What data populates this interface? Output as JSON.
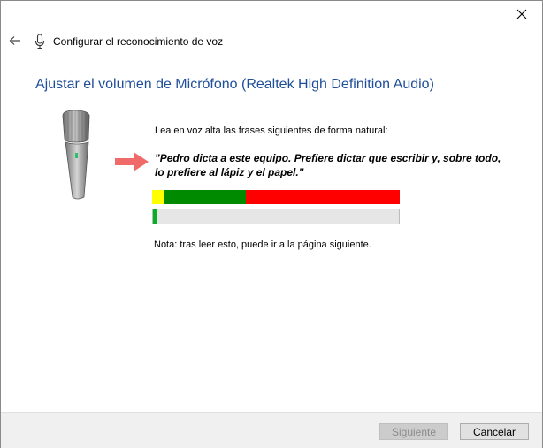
{
  "titlebar": {
    "close_icon": "close-icon"
  },
  "nav": {
    "back_icon": "arrow-left-icon",
    "mic_icon": "microphone-icon",
    "title": "Configurar el reconocimiento de voz"
  },
  "main": {
    "heading": "Ajustar el volumen de Micrófono (Realtek High Definition Audio)",
    "instruction": "Lea en voz alta las frases siguientes de forma natural:",
    "phrase": "\"Pedro dicta a este equipo. Prefiere dictar que escribir y, sobre todo, lo prefiere al lápiz y el papel.\"",
    "note": "Nota: tras leer esto, puede ir a la página siguiente.",
    "volume_meter": {
      "zones": [
        {
          "color": "#ffff00",
          "fraction": 0.05
        },
        {
          "color": "#008a00",
          "fraction": 0.33
        },
        {
          "color": "#ff0000",
          "fraction": 0.62
        }
      ]
    },
    "input_level": {
      "fraction": 0.015,
      "color": "#06b025"
    },
    "accent_color": "#1f4e9a",
    "arrow_color": "#f06060"
  },
  "footer": {
    "next_label": "Siguiente",
    "cancel_label": "Cancelar"
  }
}
